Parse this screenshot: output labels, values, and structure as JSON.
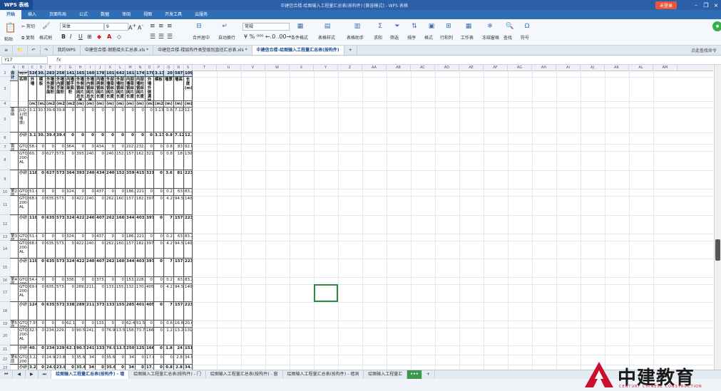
{
  "window": {
    "app_name": "WPS 表格",
    "doc_title": "中建信合楼-给图输入工程量汇总表(按构件) [兼容模式] - WPS 表格",
    "login": "未登录"
  },
  "menu": [
    "开始",
    "插入",
    "页面布局",
    "公式",
    "数据",
    "审阅",
    "视图",
    "开发工具",
    "云服务"
  ],
  "ribbon": {
    "paste": "粘贴",
    "cut": "剪切",
    "copy": "复制",
    "format_painter": "格式刷",
    "font_name": "宋体",
    "font_size": "9",
    "merge_center": "合并居中",
    "wrap": "自动换行",
    "number_format": "常规",
    "cond_format": "条件格式",
    "table_style": "表格样式",
    "symbol": "符号",
    "sum": "求和",
    "filter": "筛选",
    "sort": "排序",
    "format": "格式",
    "row_col": "行和列",
    "worksheet": "工作表",
    "freeze": "冻结窗格",
    "find": "查找",
    "symbols": "符号",
    "doc_helper": "表格助手"
  },
  "file_tabs": [
    {
      "label": "我的WPS",
      "active": false
    },
    {
      "label": "中建信合楼-钢筋接头汇总表.xls *",
      "active": false
    },
    {
      "label": "中建信合楼-楼层构件类型级别直径汇总表.xls *",
      "active": false
    },
    {
      "label": "中建信合楼-给图输入工程量汇总表(按构件)",
      "active": true
    }
  ],
  "file_tab_tip": "点此查找命令",
  "formula_bar": {
    "cell_ref": "Y17",
    "fx": "fx"
  },
  "columns": [
    "A",
    "B",
    "C",
    "D",
    "E",
    "F",
    "G",
    "H",
    "I",
    "J",
    "K",
    "L",
    "M",
    "N",
    "O",
    "P",
    "Q",
    "R",
    "S",
    "T",
    "U",
    "V",
    "W",
    "X",
    "Y",
    "Z",
    "AA",
    "AB",
    "AC",
    "AD",
    "AE",
    "AF",
    "AG",
    "AH",
    "AI",
    "AJ",
    "AK",
    "AL",
    "AM"
  ],
  "rows": [
    "2",
    "3",
    "4",
    "5",
    "6",
    "7",
    "8",
    "9",
    "10",
    "11",
    "12",
    "13",
    "14",
    "15",
    "16",
    "17",
    "18",
    "19",
    "20",
    "21",
    "22",
    "23"
  ],
  "sheet": {
    "title_header": "工程量名称",
    "corner_top": "构件",
    "corner_left_top": "楼",
    "floor_label": "层",
    "name_label": "名称",
    "col_headers": [
      "外墙",
      "模板",
      "外墙外脚手架面积",
      "外墙内脚手架面积",
      "内墙脚手架面积",
      "外墙外侧钢丝网片总长度",
      "外墙内侧钢丝网片总长度",
      "内墙两侧钢丝网片长度",
      "外部墙梁钢丝网片长度",
      "外部墙柱钢丝网片长度",
      "内部墙梁钢丝网片长度",
      "内部墙柱钢丝网片长度",
      "外墙外侧满挂钢丝网片长度",
      "模板",
      "墙厚",
      "墙高",
      "长度(m)"
    ],
    "units": [
      "(m3)",
      "(m2)",
      "(m2)",
      "(m2)",
      "(m2)",
      "(m)",
      "(m)",
      "(m)",
      "(m)",
      "(m)",
      "(m)",
      "(m)",
      "(m)",
      "(m2)",
      "(m)",
      "(m)",
      "(m)"
    ],
    "body_rows": [
      {
        "floor": "基础",
        "name": "JLQ-1(砼墙体)",
        "vals": [
          "3.139",
          "30.5",
          "39.6",
          "39.6",
          "0",
          "0",
          "0",
          "0",
          "0",
          "0",
          "0",
          "0",
          "0",
          "3.139",
          "0.8",
          "7.12",
          "12.4"
        ],
        "bold": false
      },
      {
        "floor": "",
        "name": "小计",
        "vals": [
          "3.1391",
          "30.6",
          "39.6",
          "39.6",
          "0",
          "0",
          "0",
          "0",
          "0",
          "0",
          "0",
          "0",
          "0",
          "3.1391",
          "0.8",
          "7.12",
          "12.4"
        ],
        "bold": true
      },
      {
        "floor": "首层",
        "name": "GTQ-200",
        "vals": [
          "58.46",
          "0",
          "0",
          "0",
          "364.0",
          "0",
          "0",
          "434.5",
          "0",
          "0",
          "202.1",
          "232.4",
          "0",
          "0",
          "0.8",
          "83",
          "92.85"
        ],
        "bold": false
      },
      {
        "floor": "",
        "name": "GTQ-200-AL",
        "vals": [
          "60.15",
          "0",
          "627.7",
          "573.3",
          "0",
          "393.2",
          "240.5",
          "0",
          "240.8",
          "152.4",
          "157.7",
          "162.7",
          "321.1",
          "0",
          "0.8",
          "18",
          "130.8"
        ],
        "bold": false
      },
      {
        "floor": "",
        "name": "小计",
        "vals": [
          "118.5731",
          "0",
          "627.732",
          "573.3",
          "364.05",
          "393.2",
          "240.5",
          "434.55",
          "240.8",
          "152.4",
          "359.8",
          "415.15",
          "321.19",
          "0",
          "3.6",
          "81",
          "223.65"
        ],
        "bold": true
      },
      {
        "floor": "第2层",
        "name": "GTQ-200",
        "vals": [
          "51.47",
          "0",
          "0",
          "0",
          "324.3",
          "0",
          "0",
          "437.8",
          "0",
          "0",
          "186.8",
          "221",
          "0",
          "0",
          "0.2",
          "63",
          "83.25"
        ],
        "bold": false
      },
      {
        "floor": "",
        "name": "GTQ-200-AL",
        "vals": [
          "68.05",
          "0",
          "635.4",
          "573.3",
          "0",
          "422.3",
          "240.5",
          "0",
          "262.1",
          "160.2",
          "157.7",
          "182.7",
          "397.0",
          "0",
          "4.2",
          "94.5",
          "140.4"
        ],
        "bold": false
      },
      {
        "floor": "",
        "name": "小计",
        "vals": [
          "119.526",
          "0",
          "635.4",
          "573.3",
          "324.3926",
          "422.3",
          "240.5",
          "407.85",
          "262.1",
          "160.2",
          "344.6",
          "403.75",
          "397.05",
          "0",
          "7",
          "157.5",
          "223.65"
        ],
        "bold": true
      },
      {
        "floor": "第3层",
        "name": "GTQ-200",
        "vals": [
          "51.47",
          "0",
          "0",
          "0",
          "324.3",
          "0",
          "0",
          "437.8",
          "0",
          "0",
          "186.8",
          "221",
          "0",
          "0",
          "0.2",
          "63",
          "83.25"
        ],
        "bold": false
      },
      {
        "floor": "",
        "name": "GTQ-200-AL",
        "vals": [
          "68.05",
          "0",
          "635.4",
          "573.3",
          "0",
          "422.3",
          "240.5",
          "0",
          "262.1",
          "160.2",
          "157.7",
          "182.7",
          "397.0",
          "0",
          "4.2",
          "94.5",
          "140.4"
        ],
        "bold": false
      },
      {
        "floor": "",
        "name": "小计",
        "vals": [
          "119.5259",
          "0",
          "635.4",
          "573.3",
          "324.3926",
          "422.3",
          "240.5",
          "407.85",
          "262.1",
          "160.2",
          "344.6",
          "403.75",
          "397.05",
          "0",
          "7",
          "157.5",
          "223.65"
        ],
        "bold": true
      },
      {
        "floor": "第4层",
        "name": "GTQ-200",
        "vals": [
          "54.41",
          "0",
          "0",
          "0",
          "338.7",
          "0",
          "0",
          "373.3",
          "0",
          "0",
          "153.4",
          "228.8",
          "0",
          "0",
          "0.2",
          "63",
          "83.25"
        ],
        "bold": false
      },
      {
        "floor": "",
        "name": "GTQ-200-AL",
        "vals": [
          "69.68",
          "0",
          "635.4",
          "573.3",
          "0",
          "289.5",
          "211.2",
          "0",
          "133.6",
          "155.9",
          "132.4",
          "170.7",
          "405.9",
          "0",
          "4.2",
          "94.5",
          "140.4"
        ],
        "bold": false
      },
      {
        "floor": "",
        "name": "小计",
        "vals": [
          "124.1009",
          "0",
          "635.4",
          "573.3",
          "338.7458",
          "289.5243",
          "211.2122",
          "373.3262",
          "133.6167",
          "155.9109",
          "285.8",
          "401.6276",
          "405.9698",
          "0",
          "7",
          "157.5",
          "223.65"
        ],
        "bold": true
      },
      {
        "floor": "第5层",
        "name": "GTQ-200",
        "vals": [
          "7.559",
          "0",
          "0",
          "0",
          "62.14",
          "0",
          "0",
          "133.9",
          "0",
          "0",
          "62.43",
          "51.54",
          "0",
          "0",
          "0.6",
          "16.8",
          "20.6"
        ],
        "bold": false
      },
      {
        "floor": "",
        "name": "GTQ-200-AL",
        "vals": [
          "32.94",
          "0",
          "234.7",
          "229.3",
          "0",
          "90.56",
          "241.8",
          "0",
          "76.98",
          "13.59",
          "158.1",
          "73.75",
          "166.4",
          "0",
          "1.2",
          "13.2",
          "131"
        ],
        "bold": false
      },
      {
        "floor": "",
        "name": "小计",
        "vals": [
          "40.5023",
          "0",
          "234.78",
          "229.3",
          "62.14",
          "90.5602",
          "241.8554",
          "133.9967",
          "76.9645",
          "13.5957",
          "250.5527",
          "125.2994",
          "166.4078",
          "0",
          "1.8",
          "24",
          "151.6"
        ],
        "bold": true
      },
      {
        "floor": "第6层",
        "name": "GTQ-200",
        "vals": [
          "3.224",
          "0",
          "24.9",
          "23.8",
          "0",
          "35.6",
          "34",
          "0",
          "35.6",
          "0",
          "34",
          "0",
          "17.8",
          "0",
          "0",
          "2.8",
          "34.8"
        ],
        "bold": false
      },
      {
        "floor": "",
        "name": "小计",
        "vals": [
          "3.2246",
          "0",
          "24.9",
          "23.8",
          "0",
          "35.6",
          "34",
          "0",
          "35.6",
          "0",
          "34",
          "0",
          "17.8",
          "0",
          "0.8",
          "2.8",
          "34.8"
        ],
        "bold": true
      },
      {
        "floor": "合计",
        "name": "",
        "vals": [
          "526.5",
          "30.6",
          "2833",
          "2581",
          "1413.",
          "1653.",
          "1608",
          "1787",
          "1011",
          "642.9",
          "1618.",
          "1749.",
          "1707.",
          "3.139",
          "20",
          "587.4",
          "1090.4"
        ],
        "bold": true,
        "total": true
      }
    ]
  },
  "sheet_tabs": [
    {
      "label": "绘图输入工程量汇总表(按构件) - 墙",
      "active": true
    },
    {
      "label": "绘图输入工程量汇总表(按构件) - 门",
      "active": false
    },
    {
      "label": "绘图输入工程量汇总表(按构件) - 窗",
      "active": false
    },
    {
      "label": "绘图输入工程量汇总表(按构件) - 墙洞",
      "active": false
    },
    {
      "label": "绘图输入工程量汇",
      "active": false
    },
    {
      "label": "•••",
      "active": false,
      "more": true
    },
    {
      "label": "+",
      "active": false
    }
  ],
  "logo": {
    "text": "中建教育",
    "sub": "CENTURY CHINESE CONSTRUCTION"
  }
}
